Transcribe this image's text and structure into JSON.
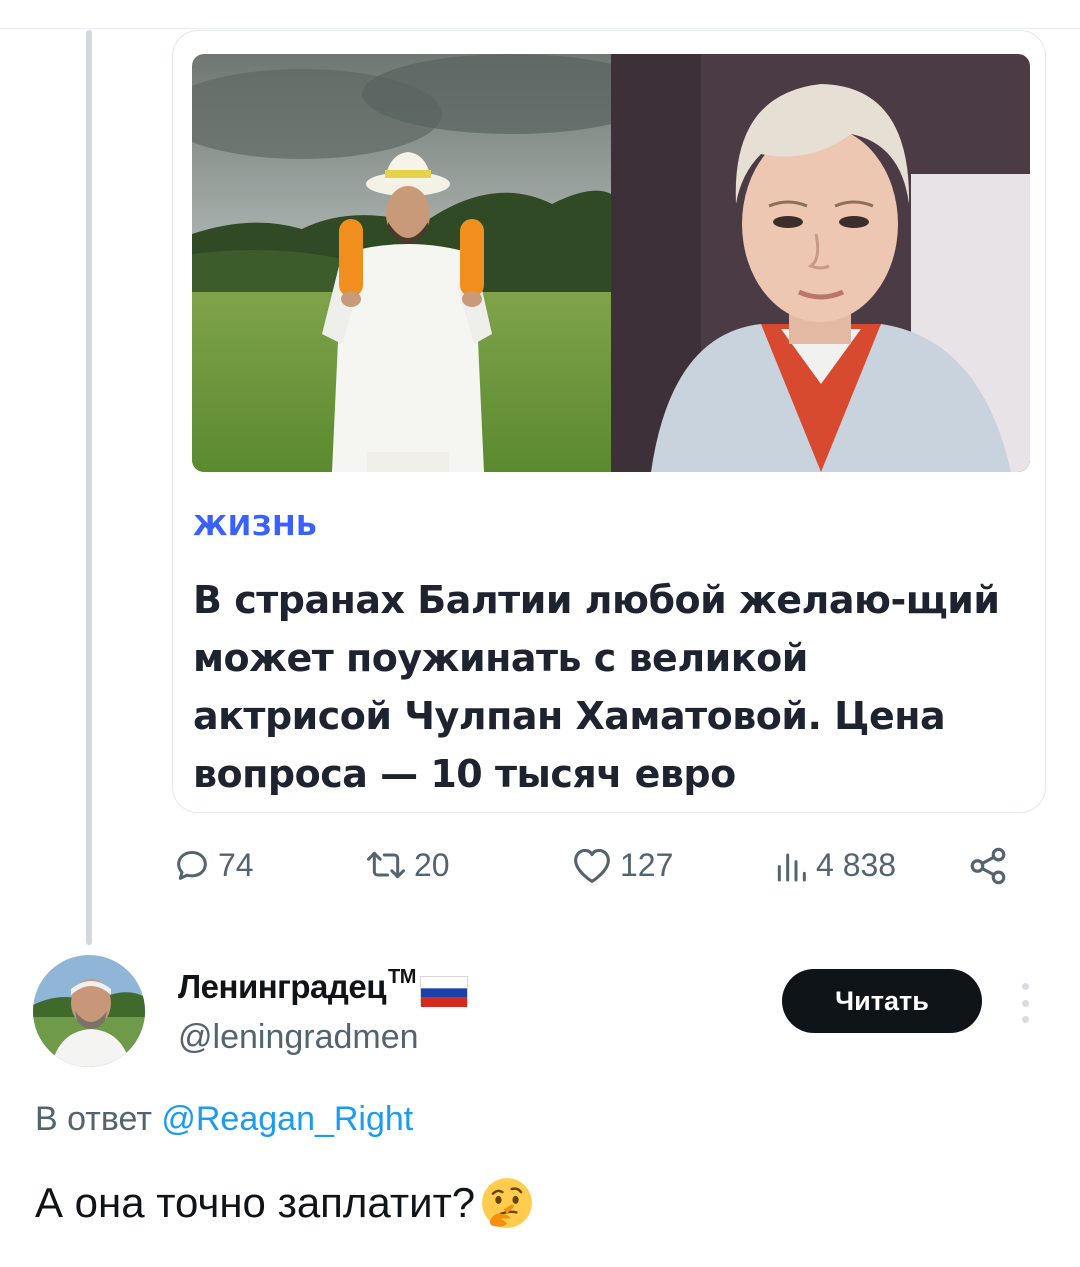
{
  "embedded_card": {
    "category": "ЖИЗНЬ",
    "headline": "В странах Балтии любой желаю-щий может поужинать с великой актрисой Чулпан Хаматовой. Цена вопроса — 10 тысяч евро",
    "images": [
      "man-with-zucchini-photo",
      "woman-portrait-photo"
    ]
  },
  "actions": {
    "replies": "74",
    "retweets": "20",
    "likes": "127",
    "views": "4 838"
  },
  "reply": {
    "author_name": "Ленинградец",
    "author_suffix": "TM",
    "author_flag": "russian-flag",
    "author_handle": "@leningradmen",
    "follow_label": "Читать",
    "reply_prefix": "В ответ",
    "reply_mention": "@Reagan_Right",
    "text": "А она точно заплатит?",
    "emoji": "thinking-face-emoji"
  },
  "colors": {
    "accent": "#1d9bf0",
    "category": "#3a61ff",
    "muted": "#536471",
    "button_bg": "#0f1419"
  }
}
